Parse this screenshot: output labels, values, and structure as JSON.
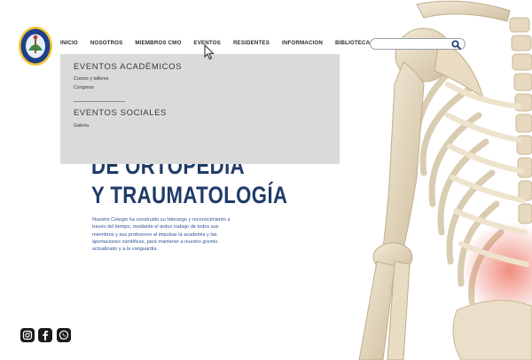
{
  "header": {
    "logo_name": "college-seal-logo",
    "nav": [
      "INICIO",
      "NOSOTROS",
      "MIEMBROS CMO",
      "EVENTOS",
      "RESIDENTES",
      "INFORMACION",
      "BIBLIOTECA"
    ],
    "search": {
      "value": "",
      "placeholder": ""
    }
  },
  "dropdown": {
    "academic_heading": "EVENTOS ACADÉMICOS",
    "academic_items": [
      "Cursos y talleres",
      "Congreso"
    ],
    "social_heading": "EVENTOS SOCIALES",
    "social_items": [
      "Galeria"
    ]
  },
  "hero": {
    "title_line1": "DE ORTOPEDIA",
    "title_line2": "Y TRAUMATOLOGÍA",
    "body_lines": [
      "Nuestro Colegio ha construido su liderazgo y reconocimiento a",
      "través del tiempo, mediante el arduo trabajo de todos sus",
      "miembros y sus profesores al impulsar la academia y las",
      "aportaciones científicas, para mantener a nuestro gremio",
      "actualizado y a la vanguardia."
    ]
  },
  "social": [
    "instagram-icon",
    "facebook-icon",
    "whatsapp-icon"
  ],
  "colors": {
    "title": "#1f3a68",
    "body": "#2f5596",
    "dropdown_bg": "#d7d7d7",
    "accent_red": "#e8503a"
  }
}
